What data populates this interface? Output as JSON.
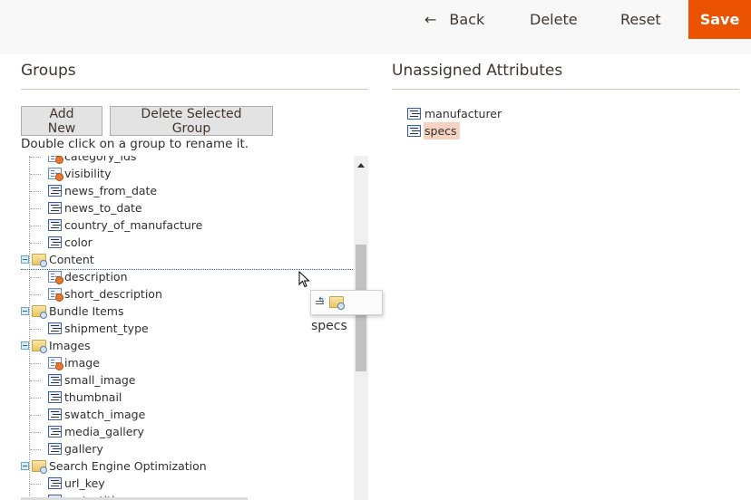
{
  "toolbar": {
    "back_label": "Back",
    "back_icon": "arrow-left-icon",
    "delete_label": "Delete",
    "reset_label": "Reset",
    "save_label": "Save",
    "save_color": "#eb5202"
  },
  "groups": {
    "title": "Groups",
    "add_new_label": "Add New",
    "delete_selected_label": "Delete Selected Group",
    "hint": "Double click on a group to rename it.",
    "tree": [
      {
        "type": "leaf",
        "label": "category_ids",
        "icon": "system-attribute-icon",
        "partial": true
      },
      {
        "type": "leaf",
        "label": "visibility",
        "icon": "system-attribute-icon"
      },
      {
        "type": "leaf",
        "label": "news_from_date",
        "icon": "attribute-icon"
      },
      {
        "type": "leaf",
        "label": "news_to_date",
        "icon": "attribute-icon"
      },
      {
        "type": "leaf",
        "label": "country_of_manufacture",
        "icon": "attribute-icon"
      },
      {
        "type": "leaf",
        "label": "color",
        "icon": "attribute-icon"
      },
      {
        "type": "group",
        "label": "Content",
        "icon": "folder-icon",
        "expanded": true
      },
      {
        "type": "leaf",
        "label": "description",
        "icon": "system-attribute-icon"
      },
      {
        "type": "leaf",
        "label": "short_description",
        "icon": "system-attribute-icon"
      },
      {
        "type": "group",
        "label": "Bundle Items",
        "icon": "folder-icon",
        "expanded": true
      },
      {
        "type": "leaf",
        "label": "shipment_type",
        "icon": "attribute-icon"
      },
      {
        "type": "group",
        "label": "Images",
        "icon": "folder-icon",
        "expanded": true
      },
      {
        "type": "leaf",
        "label": "image",
        "icon": "system-attribute-icon"
      },
      {
        "type": "leaf",
        "label": "small_image",
        "icon": "attribute-icon"
      },
      {
        "type": "leaf",
        "label": "thumbnail",
        "icon": "attribute-icon"
      },
      {
        "type": "leaf",
        "label": "swatch_image",
        "icon": "attribute-icon"
      },
      {
        "type": "leaf",
        "label": "media_gallery",
        "icon": "attribute-icon"
      },
      {
        "type": "leaf",
        "label": "gallery",
        "icon": "attribute-icon"
      },
      {
        "type": "group",
        "label": "Search Engine Optimization",
        "icon": "folder-icon",
        "expanded": true
      },
      {
        "type": "leaf",
        "label": "url_key",
        "icon": "attribute-icon"
      },
      {
        "type": "leaf",
        "label": "meta_title",
        "icon": "attribute-icon",
        "partial": true
      }
    ]
  },
  "drag": {
    "label": "specs"
  },
  "unassigned": {
    "title": "Unassigned Attributes",
    "items": [
      {
        "label": "manufacturer",
        "selected": false
      },
      {
        "label": "specs",
        "selected": true
      }
    ]
  }
}
